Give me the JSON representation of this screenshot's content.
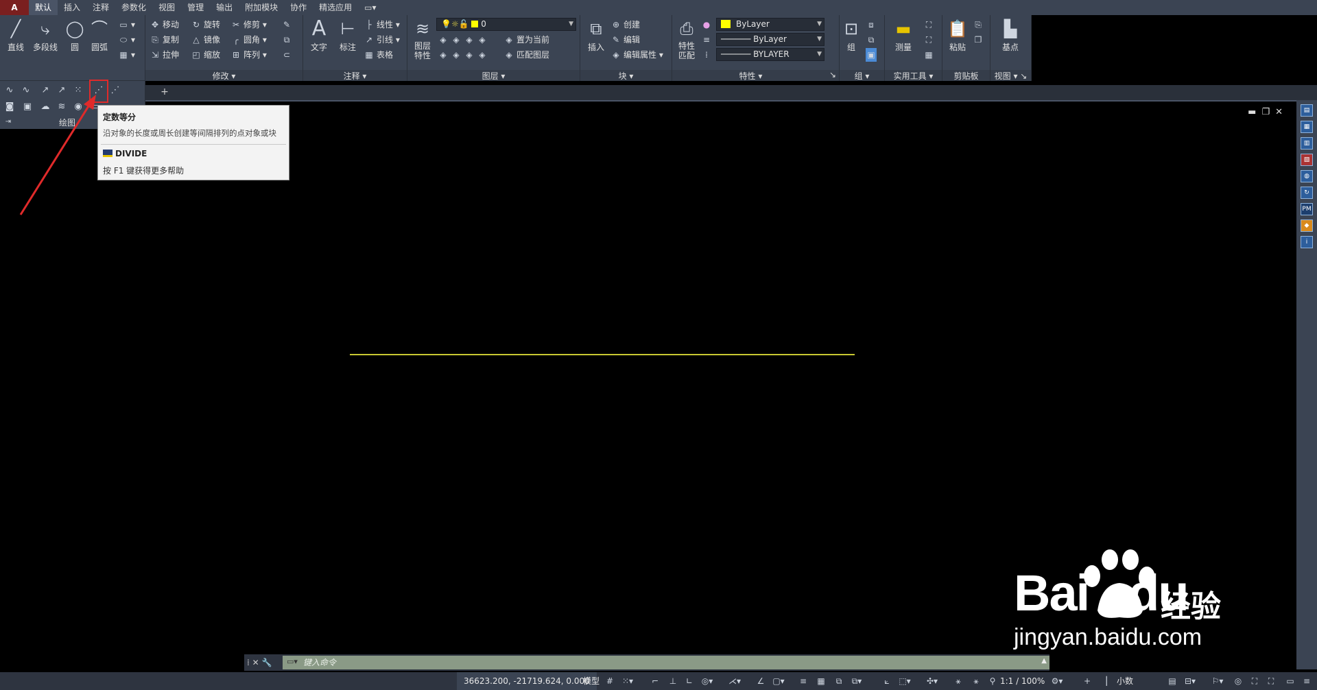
{
  "tabs": [
    "默认",
    "插入",
    "注释",
    "参数化",
    "视图",
    "管理",
    "输出",
    "附加模块",
    "协作",
    "精选应用"
  ],
  "draw_panel": {
    "line": "直线",
    "polyline": "多段线",
    "circle": "圆",
    "arc": "圆弧",
    "title": "绘图"
  },
  "modify_panel": {
    "move": "移动",
    "rotate": "旋转",
    "trim": "修剪",
    "copy": "复制",
    "mirror": "镜像",
    "fillet": "圆角",
    "stretch": "拉伸",
    "scale": "缩放",
    "array": "阵列",
    "title": "修改"
  },
  "annotation_panel": {
    "text": "文字",
    "dimension": "标注",
    "linear": "线性",
    "leader": "引线",
    "table": "表格",
    "title": "注释"
  },
  "layers_panel": {
    "layer_properties": "图层特性",
    "current_layer": "0",
    "set_current": "置为当前",
    "match_layer": "匹配图层",
    "title": "图层"
  },
  "block_panel": {
    "insert": "插入",
    "create": "创建",
    "edit": "编辑",
    "edit_attributes": "编辑属性",
    "title": "块"
  },
  "properties_panel": {
    "match": "特性匹配",
    "color": "ByLayer",
    "linetype": "ByLayer",
    "lineweight": "BYLAYER",
    "title": "特性"
  },
  "groups_panel": {
    "group": "组",
    "title": "组"
  },
  "utilities_panel": {
    "measure": "测量",
    "title": "实用工具"
  },
  "clipboard_panel": {
    "paste": "粘贴",
    "title": "剪贴板"
  },
  "view_panel": {
    "base": "基点",
    "title": "视图"
  },
  "tooltip": {
    "title": "定数等分",
    "description": "沿对象的长度或周长创建等间隔排列的点对象或块",
    "command": "DIVIDE",
    "help": "按 F1 键获得更多帮助"
  },
  "command_line": {
    "placeholder": "键入命令"
  },
  "status": {
    "coords": "36623.200, -21719.624, 0.000",
    "model": "模型",
    "scale": "1:1 / 100%",
    "units": "小数"
  },
  "right_bar": {
    "pm": "PM"
  },
  "watermark": {
    "brand": "Bai",
    "brand2": "du",
    "suffix": "经验",
    "url": "jingyan.baidu.com"
  },
  "colors": {
    "accent": "#e02a2a",
    "line": "#c8c832",
    "tooltip_bg": "#f3f3f3",
    "ribbon_bg": "#3b4453"
  }
}
